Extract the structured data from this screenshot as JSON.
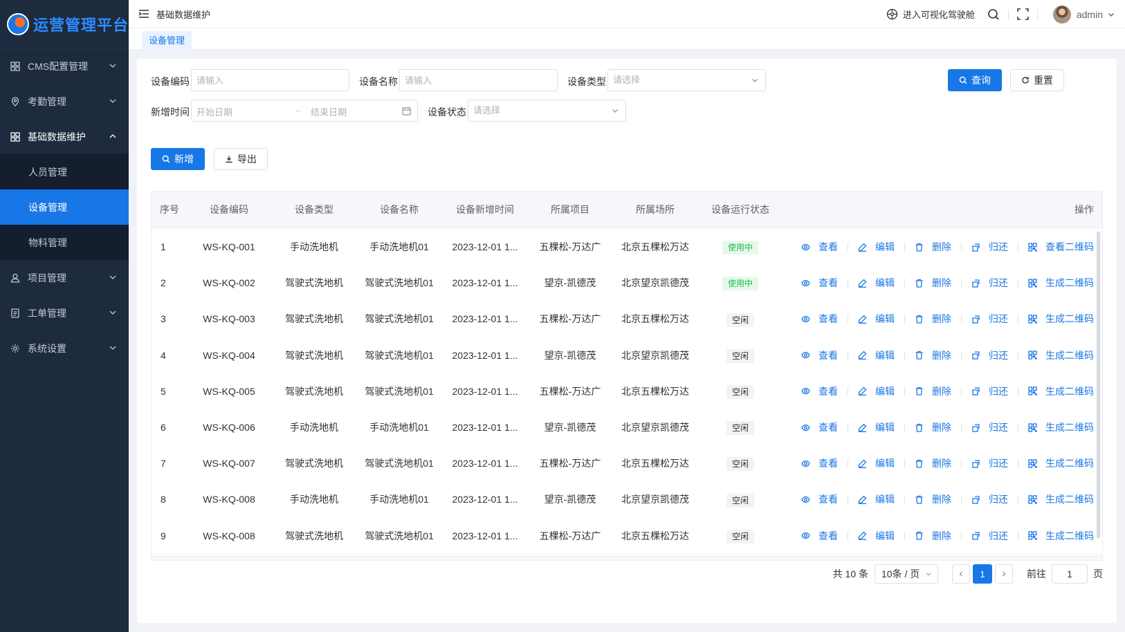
{
  "app": {
    "logo_text": "运营管理平台"
  },
  "sidebar": {
    "items": [
      {
        "label": "CMS配置管理",
        "icon": "grid-icon"
      },
      {
        "label": "考勤管理",
        "icon": "location-pin-icon"
      },
      {
        "label": "基础数据维护",
        "icon": "grid-icon",
        "open": true,
        "children": [
          {
            "label": "人员管理"
          },
          {
            "label": "设备管理",
            "active": true
          },
          {
            "label": "物料管理"
          }
        ]
      },
      {
        "label": "项目管理",
        "icon": "user-icon"
      },
      {
        "label": "工单管理",
        "icon": "document-icon"
      },
      {
        "label": "系统设置",
        "icon": "gear-icon"
      }
    ]
  },
  "topbar": {
    "breadcrumb": "基础数据维护",
    "viz_link": "进入可视化驾驶舱",
    "user_name": "admin"
  },
  "tags": [
    {
      "label": "设备管理"
    }
  ],
  "filters": {
    "code_label": "设备编码",
    "code_placeholder": "请输入",
    "name_label": "设备名称",
    "name_placeholder": "请输入",
    "type_label": "设备类型",
    "type_placeholder": "请选择",
    "time_label": "新增时间",
    "start_placeholder": "开始日期",
    "range_sep": "–",
    "end_placeholder": "结束日期",
    "status_label": "设备状态",
    "status_placeholder": "请选择",
    "search_button": "查询",
    "reset_button": "重置"
  },
  "toolbar": {
    "add_button": "新增",
    "export_button": "导出"
  },
  "table": {
    "columns": [
      "序号",
      "设备编码",
      "设备类型",
      "设备名称",
      "设备新增时间",
      "所属项目",
      "所属场所",
      "设备运行状态",
      "操作"
    ],
    "actions": {
      "view": "查看",
      "edit": "编辑",
      "delete": "删除",
      "return": "归还"
    },
    "rows": [
      {
        "idx": "1",
        "code": "WS-KQ-001",
        "type": "手动洗地机",
        "name": "手动洗地机01",
        "time": "2023-12-01 1...",
        "project": "五棵松-万达广",
        "place": "北京五棵松万达",
        "status": "使用中",
        "status_kind": "used",
        "qr": "查看二维码"
      },
      {
        "idx": "2",
        "code": "WS-KQ-002",
        "type": "驾驶式洗地机",
        "name": "驾驶式洗地机01",
        "time": "2023-12-01 1...",
        "project": "望京-凯德茂",
        "place": "北京望京凯德茂",
        "status": "使用中",
        "status_kind": "used",
        "qr": "生成二维码"
      },
      {
        "idx": "3",
        "code": "WS-KQ-003",
        "type": "驾驶式洗地机",
        "name": "驾驶式洗地机01",
        "time": "2023-12-01 1...",
        "project": "五棵松-万达广",
        "place": "北京五棵松万达",
        "status": "空闲",
        "status_kind": "idle",
        "qr": "生成二维码"
      },
      {
        "idx": "4",
        "code": "WS-KQ-004",
        "type": "驾驶式洗地机",
        "name": "驾驶式洗地机01",
        "time": "2023-12-01 1...",
        "project": "望京-凯德茂",
        "place": "北京望京凯德茂",
        "status": "空闲",
        "status_kind": "idle",
        "qr": "生成二维码"
      },
      {
        "idx": "5",
        "code": "WS-KQ-005",
        "type": "驾驶式洗地机",
        "name": "驾驶式洗地机01",
        "time": "2023-12-01 1...",
        "project": "五棵松-万达广",
        "place": "北京五棵松万达",
        "status": "空闲",
        "status_kind": "idle",
        "qr": "生成二维码"
      },
      {
        "idx": "6",
        "code": "WS-KQ-006",
        "type": "手动洗地机",
        "name": "手动洗地机01",
        "time": "2023-12-01 1...",
        "project": "望京-凯德茂",
        "place": "北京望京凯德茂",
        "status": "空闲",
        "status_kind": "idle",
        "qr": "生成二维码"
      },
      {
        "idx": "7",
        "code": "WS-KQ-007",
        "type": "驾驶式洗地机",
        "name": "驾驶式洗地机01",
        "time": "2023-12-01 1...",
        "project": "五棵松-万达广",
        "place": "北京五棵松万达",
        "status": "空闲",
        "status_kind": "idle",
        "qr": "生成二维码"
      },
      {
        "idx": "8",
        "code": "WS-KQ-008",
        "type": "手动洗地机",
        "name": "手动洗地机01",
        "time": "2023-12-01 1...",
        "project": "望京-凯德茂",
        "place": "北京望京凯德茂",
        "status": "空闲",
        "status_kind": "idle",
        "qr": "生成二维码"
      },
      {
        "idx": "9",
        "code": "WS-KQ-008",
        "type": "驾驶式洗地机",
        "name": "驾驶式洗地机01",
        "time": "2023-12-01 1...",
        "project": "五棵松-万达广",
        "place": "北京五棵松万达",
        "status": "空闲",
        "status_kind": "idle",
        "qr": "生成二维码"
      }
    ]
  },
  "pagination": {
    "total_text": "共 10 条",
    "page_size": "10条 / 页",
    "current_page": "1",
    "goto_label": "前往",
    "goto_value": "1",
    "page_unit": "页"
  },
  "colors": {
    "primary": "#1877e6",
    "sidebar_bg": "#1e2a3e",
    "success": "#19be4b"
  }
}
